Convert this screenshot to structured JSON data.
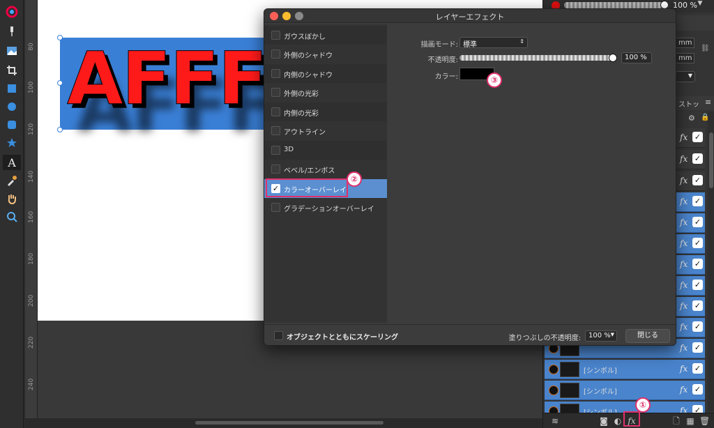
{
  "canvas": {
    "headline_text": "AFFF",
    "ruler_labels": [
      "80",
      "100",
      "120",
      "140",
      "160",
      "180",
      "200",
      "220",
      "240"
    ]
  },
  "right_panel": {
    "opacity_value": "100 %",
    "unit_mm": "mm",
    "tab_partial": "ストッ",
    "layers": [
      {
        "name": "",
        "selected": false
      },
      {
        "name": "",
        "selected": false
      },
      {
        "name": "",
        "selected": false
      },
      {
        "name": "",
        "selected": true
      },
      {
        "name": "",
        "selected": true
      },
      {
        "name": "",
        "selected": true
      },
      {
        "name": "",
        "selected": true
      },
      {
        "name": "",
        "selected": true
      },
      {
        "name": "",
        "selected": true
      },
      {
        "name": "",
        "selected": true
      },
      {
        "name": "",
        "selected": true
      },
      {
        "name": "[シンボル]",
        "selected": true
      },
      {
        "name": "[シンボル]",
        "selected": true
      },
      {
        "name": "[シンボル]",
        "selected": true
      }
    ],
    "fx_label": "fx",
    "check_glyph": "✓"
  },
  "dialog": {
    "title": "レイヤーエフェクト",
    "effects": [
      {
        "label": "ガウスぼかし",
        "checked": false
      },
      {
        "label": "外側のシャドウ",
        "checked": false
      },
      {
        "label": "内側のシャドウ",
        "checked": false
      },
      {
        "label": "外側の光彩",
        "checked": false
      },
      {
        "label": "内側の光彩",
        "checked": false
      },
      {
        "label": "アウトライン",
        "checked": false
      },
      {
        "label": "3D",
        "checked": false
      },
      {
        "label": "ベベル/エンボス",
        "checked": false
      },
      {
        "label": "カラーオーバーレイ",
        "checked": true
      },
      {
        "label": "グラデーションオーバーレイ",
        "checked": false
      }
    ],
    "blend_mode_label": "描画モード:",
    "blend_mode_value": "標準",
    "opacity_label": "不透明度:",
    "opacity_value": "100 %",
    "opacity_fraction": 1.0,
    "color_label": "カラー:",
    "color_value": "#000000",
    "scale_with_object_label": "オブジェクトとともにスケーリング",
    "fill_opacity_label": "塗りつぶしの不透明度:",
    "fill_opacity_value": "100 %",
    "close_label": "閉じる"
  },
  "annotations": {
    "badge1": "①",
    "badge2": "②",
    "badge3": "③"
  },
  "colors": {
    "accent_select": "#5b8fd0",
    "annotation": "#e0306a",
    "text_fill": "#ff1a1a",
    "selection": "#3a7fd6"
  }
}
